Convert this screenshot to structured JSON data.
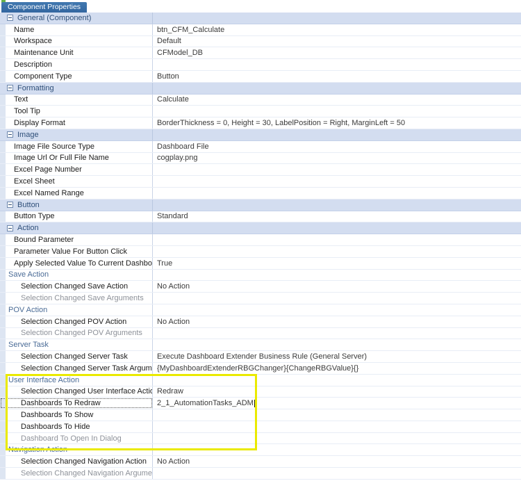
{
  "tab": {
    "label": "Component Properties",
    "accent_color": "#66b24a",
    "active_color": "#3366a0"
  },
  "annotation": {
    "color": "#eaea00",
    "note": "highlight-rectangle-around-user-interface-action-group"
  },
  "grid": {
    "rows": [
      {
        "type": "group",
        "name": "General (Component)",
        "value": ""
      },
      {
        "type": "prop",
        "name": "Name",
        "value": "btn_CFM_Calculate"
      },
      {
        "type": "prop",
        "name": "Workspace",
        "value": "Default"
      },
      {
        "type": "prop",
        "name": "Maintenance Unit",
        "value": "CFModel_DB"
      },
      {
        "type": "prop",
        "name": "Description",
        "value": ""
      },
      {
        "type": "prop",
        "name": "Component Type",
        "value": "Button"
      },
      {
        "type": "group",
        "name": "Formatting",
        "value": ""
      },
      {
        "type": "prop",
        "name": "Text",
        "value": "Calculate"
      },
      {
        "type": "prop",
        "name": "Tool Tip",
        "value": ""
      },
      {
        "type": "prop",
        "name": "Display Format",
        "value": "BorderThickness = 0, Height = 30, LabelPosition = Right, MarginLeft = 50"
      },
      {
        "type": "group",
        "name": "Image",
        "value": ""
      },
      {
        "type": "prop",
        "name": "Image File Source Type",
        "value": "Dashboard File"
      },
      {
        "type": "prop",
        "name": "Image Url Or Full File Name",
        "value": "cogplay.png"
      },
      {
        "type": "prop",
        "name": "Excel Page Number",
        "value": ""
      },
      {
        "type": "prop",
        "name": "Excel Sheet",
        "value": ""
      },
      {
        "type": "prop",
        "name": "Excel Named Range",
        "value": ""
      },
      {
        "type": "group",
        "name": "Button",
        "value": ""
      },
      {
        "type": "prop",
        "name": "Button Type",
        "value": "Standard"
      },
      {
        "type": "group",
        "name": "Action",
        "value": ""
      },
      {
        "type": "prop",
        "name": "Bound Parameter",
        "value": ""
      },
      {
        "type": "prop",
        "name": "Parameter Value For Button Click",
        "value": ""
      },
      {
        "type": "prop",
        "name": "Apply Selected Value To Current Dashboard",
        "value": "True"
      },
      {
        "type": "subgroup",
        "name": "Save Action",
        "value": ""
      },
      {
        "type": "prop2",
        "name": "Selection Changed Save Action",
        "value": "No Action"
      },
      {
        "type": "prop2dim",
        "name": "Selection Changed Save Arguments",
        "value": ""
      },
      {
        "type": "subgroup",
        "name": "POV Action",
        "value": ""
      },
      {
        "type": "prop2",
        "name": "Selection Changed POV Action",
        "value": "No Action"
      },
      {
        "type": "prop2dim",
        "name": "Selection Changed POV Arguments",
        "value": ""
      },
      {
        "type": "subgroup",
        "name": "Server Task",
        "value": ""
      },
      {
        "type": "prop2",
        "name": "Selection Changed Server Task",
        "value": "Execute Dashboard Extender Business Rule (General Server)"
      },
      {
        "type": "prop2",
        "name": "Selection Changed Server Task Arguments",
        "value": "{MyDashboardExtenderRBGChanger}{ChangeRBGValue}{}"
      },
      {
        "type": "subgroup",
        "name": "User Interface Action",
        "value": ""
      },
      {
        "type": "prop2",
        "name": "Selection Changed User Interface Action",
        "value": "Redraw"
      },
      {
        "type": "prop2focus",
        "name": "Dashboards To Redraw",
        "value": "2_1_AutomationTasks_ADM"
      },
      {
        "type": "prop2",
        "name": "Dashboards To Show",
        "value": ""
      },
      {
        "type": "prop2",
        "name": "Dashboards To Hide",
        "value": ""
      },
      {
        "type": "prop2dim",
        "name": "Dashboard To Open In Dialog",
        "value": ""
      },
      {
        "type": "subgroup",
        "name": "Navigation Action",
        "value": ""
      },
      {
        "type": "prop2",
        "name": "Selection Changed Navigation Action",
        "value": "No Action"
      },
      {
        "type": "prop2dim",
        "name": "Selection Changed Navigation Arguments",
        "value": ""
      }
    ]
  }
}
